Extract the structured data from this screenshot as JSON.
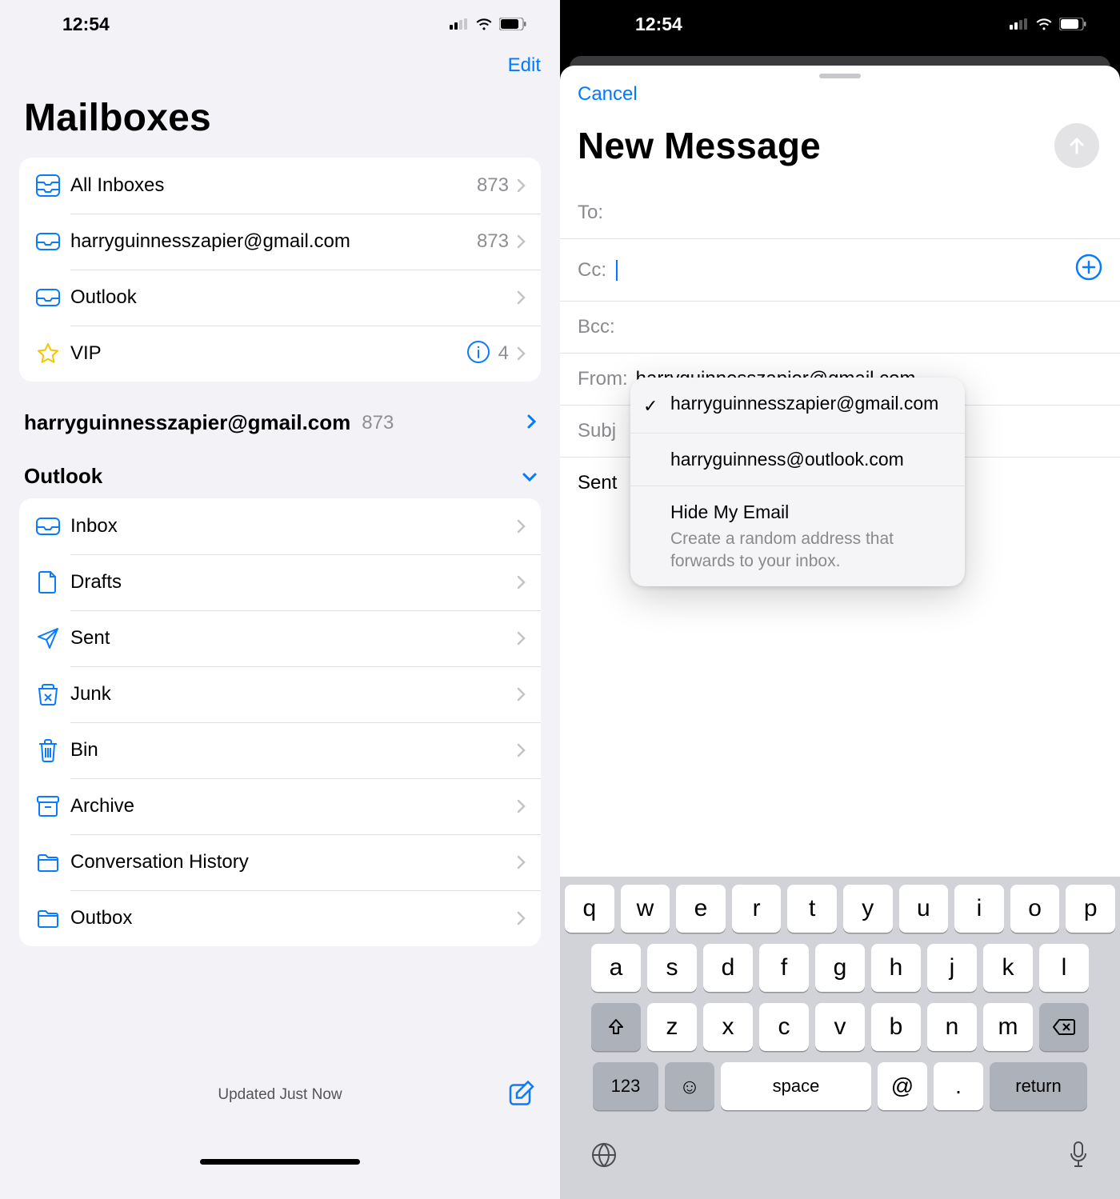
{
  "status": {
    "time": "12:54"
  },
  "left": {
    "edit": "Edit",
    "title": "Mailboxes",
    "mailboxes": [
      {
        "icon": "all-inboxes",
        "label": "All Inboxes",
        "count": "873"
      },
      {
        "icon": "inbox",
        "label": "harryguinnesszapier@gmail.com",
        "count": "873"
      },
      {
        "icon": "inbox",
        "label": "Outlook",
        "count": ""
      },
      {
        "icon": "star",
        "label": "VIP",
        "count": "4",
        "info": true
      }
    ],
    "accounts": [
      {
        "label": "harryguinnesszapier@gmail.com",
        "count": "873",
        "expanded": true
      },
      {
        "label": "Outlook",
        "count": "",
        "expanded": true
      }
    ],
    "outlook_folders": [
      {
        "icon": "inbox",
        "label": "Inbox"
      },
      {
        "icon": "doc",
        "label": "Drafts"
      },
      {
        "icon": "paperplane",
        "label": "Sent"
      },
      {
        "icon": "junk",
        "label": "Junk"
      },
      {
        "icon": "trash",
        "label": "Bin"
      },
      {
        "icon": "archive",
        "label": "Archive"
      },
      {
        "icon": "folder",
        "label": "Conversation History"
      },
      {
        "icon": "folder",
        "label": "Outbox"
      }
    ],
    "footer_status": "Updated Just Now"
  },
  "right": {
    "cancel": "Cancel",
    "title": "New Message",
    "fields": {
      "to_label": "To:",
      "cc_label": "Cc:",
      "bcc_label": "Bcc:",
      "from_label": "From:",
      "from_value": "harryguinnesszapier@gmail.com",
      "subject_label": "Subj",
      "body_preview": "Sent"
    },
    "from_menu": [
      {
        "label": "harryguinnesszapier@gmail.com",
        "checked": true
      },
      {
        "label": "harryguinness@outlook.com",
        "checked": false
      },
      {
        "label": "Hide My Email",
        "sub": "Create a random address that forwards to your inbox."
      }
    ],
    "keyboard": {
      "row1": [
        "q",
        "w",
        "e",
        "r",
        "t",
        "y",
        "u",
        "i",
        "o",
        "p"
      ],
      "row2": [
        "a",
        "s",
        "d",
        "f",
        "g",
        "h",
        "j",
        "k",
        "l"
      ],
      "row3": [
        "z",
        "x",
        "c",
        "v",
        "b",
        "n",
        "m"
      ],
      "k123": "123",
      "space": "space",
      "at": "@",
      "dot": ".",
      "return": "return"
    }
  }
}
